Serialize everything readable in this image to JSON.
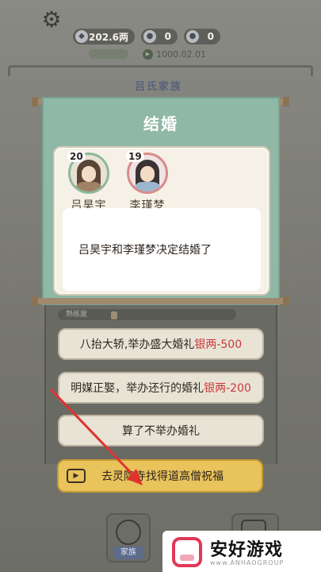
{
  "top_bar": {
    "silver_amount": "202.6两",
    "counter_a": "0",
    "counter_b": "0",
    "timer": "1000.02.01"
  },
  "background": {
    "family_title": "吕氏家族"
  },
  "modal": {
    "title": "结婚",
    "people": [
      {
        "age": "20",
        "name": "吕昊宇"
      },
      {
        "age": "19",
        "name": "李瑾梦"
      }
    ],
    "message": "吕昊宇和李瑾梦决定结婚了"
  },
  "panel": {
    "proficiency_label": "熟练度"
  },
  "options": [
    {
      "label": "八抬大轿,举办盛大婚礼",
      "cost": "银两-500"
    },
    {
      "label": "明媒正娶，举办还行的婚礼",
      "cost": "银两-200"
    },
    {
      "label": "算了不举办婚礼",
      "cost": ""
    }
  ],
  "pray_button": {
    "label": "去灵隐寺找得道高僧祝福"
  },
  "bottom_nav": {
    "family_label": "家族"
  },
  "watermark": {
    "brand": "安好游戏",
    "url": "www.ANHAOGROUP"
  },
  "colors": {
    "modal_bg": "#8fb8a6",
    "cost_red": "#c93a3a",
    "pray_gold": "#e9c35b"
  }
}
